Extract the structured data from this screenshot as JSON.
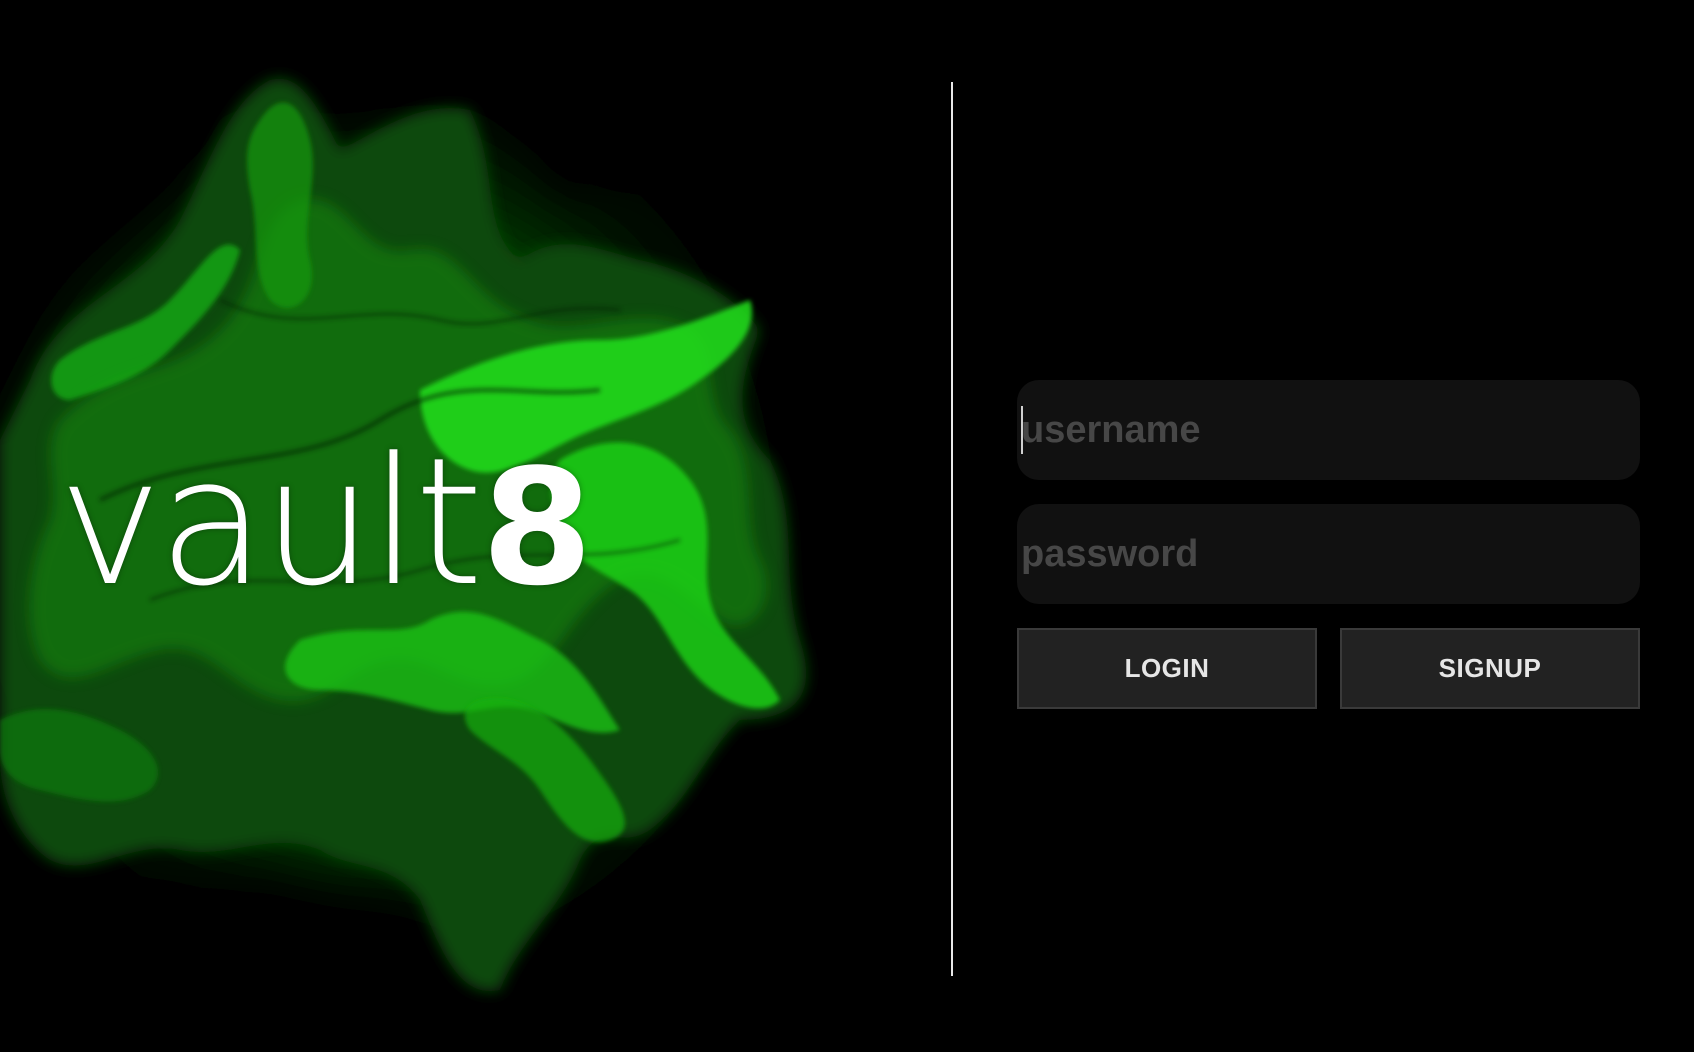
{
  "brand": {
    "logo_word": "vault",
    "logo_digit": "8",
    "accent_color": "#22e01a"
  },
  "login": {
    "username": {
      "placeholder": "username",
      "value": ""
    },
    "password": {
      "placeholder": "password",
      "value": ""
    },
    "login_label": "LOGIN",
    "signup_label": "SIGNUP"
  },
  "colors": {
    "background": "#000000",
    "field_bg": "#111111",
    "button_bg": "#222222",
    "placeholder": "#474747",
    "divider": "#e8e8e8"
  }
}
